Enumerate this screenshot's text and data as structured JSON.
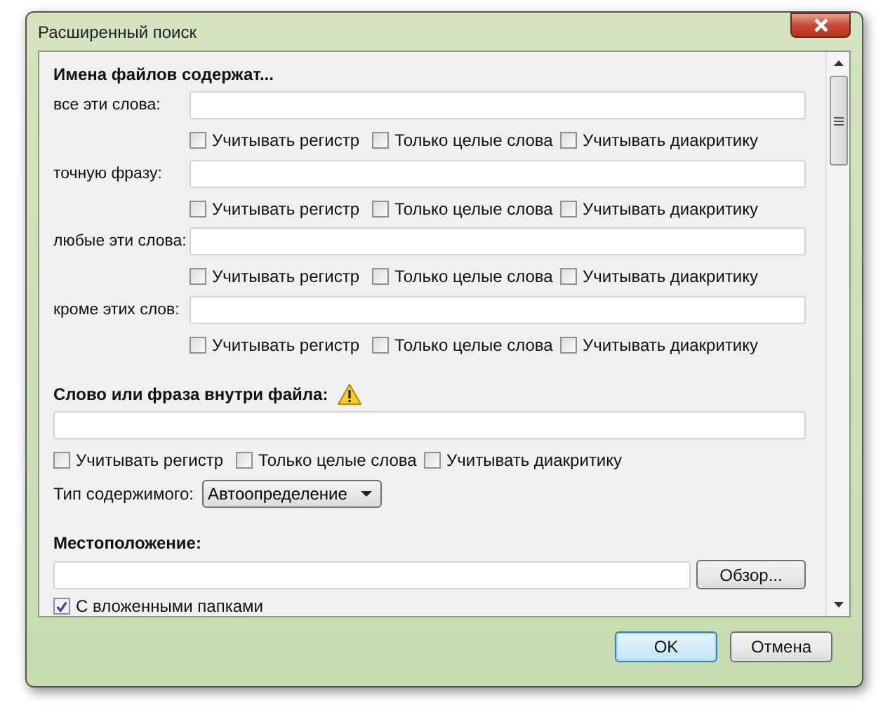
{
  "window": {
    "title": "Расширенный поиск"
  },
  "filename_section": {
    "heading": "Имена файлов содержат...",
    "rows": [
      {
        "label": "все эти слова:",
        "options": [
          {
            "label": "Учитывать регистр",
            "checked": false
          },
          {
            "label": "Только целые слова",
            "checked": false
          },
          {
            "label": "Учитывать диакритику",
            "checked": false
          }
        ]
      },
      {
        "label": "точную фразу:",
        "options": [
          {
            "label": "Учитывать регистр",
            "checked": false
          },
          {
            "label": "Только целые слова",
            "checked": false
          },
          {
            "label": "Учитывать диакритику",
            "checked": false
          }
        ]
      },
      {
        "label": "любые эти слова:",
        "options": [
          {
            "label": "Учитывать регистр",
            "checked": false
          },
          {
            "label": "Только целые слова",
            "checked": false
          },
          {
            "label": "Учитывать диакритику",
            "checked": false
          }
        ]
      },
      {
        "label": "кроме этих слов:",
        "options": [
          {
            "label": "Учитывать регистр",
            "checked": false
          },
          {
            "label": "Только целые слова",
            "checked": false
          },
          {
            "label": "Учитывать диакритику",
            "checked": false
          }
        ]
      }
    ]
  },
  "content_section": {
    "heading": "Слово или фраза внутри файла:",
    "options": [
      {
        "label": "Учитывать регистр",
        "checked": false
      },
      {
        "label": "Только целые слова",
        "checked": false
      },
      {
        "label": "Учитывать диакритику",
        "checked": false
      }
    ],
    "content_type": {
      "label": "Тип содержимого:",
      "value": "Автоопределение"
    }
  },
  "location_section": {
    "heading": "Местоположение:",
    "browse_button": "Обзор...",
    "subfolders": {
      "label": "С вложенными папками",
      "checked": true
    }
  },
  "buttons": [
    {
      "label": "OK",
      "default": true
    },
    {
      "label": "Отмена",
      "default": false
    }
  ]
}
